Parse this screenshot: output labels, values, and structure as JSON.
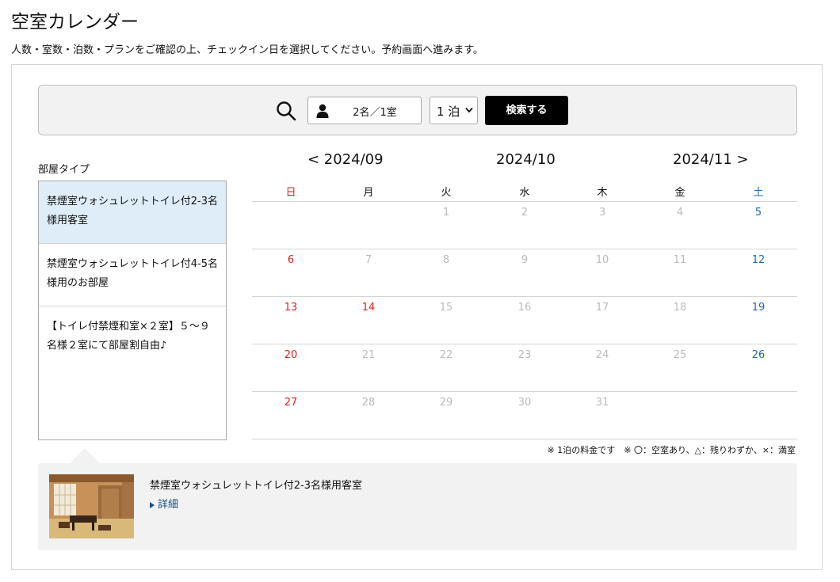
{
  "page": {
    "title": "空室カレンダー",
    "description": "人数・室数・泊数・プランをご確認の上、チェックイン日を選択してください。予約画面へ進みます。"
  },
  "search": {
    "guests_rooms": "2名／1室",
    "nights": "1 泊",
    "button_label": "検索する"
  },
  "rooms": {
    "label": "部屋タイプ",
    "items": [
      {
        "name": "禁煙室ウォシュレットトイレ付2-3名様用客室",
        "selected": true
      },
      {
        "name": "禁煙室ウォシュレットトイレ付4-5名様用のお部屋",
        "selected": false
      },
      {
        "name": "【トイレ付禁煙和室×２室】５〜９名様２室にて部屋割自由♪",
        "selected": false
      }
    ]
  },
  "calendar": {
    "prev_month": "< 2024/09",
    "current_month": "2024/10",
    "next_month": "2024/11 >",
    "weekdays": [
      "日",
      "月",
      "火",
      "水",
      "木",
      "金",
      "土"
    ],
    "weeks": [
      [
        "",
        "",
        "1",
        "2",
        "3",
        "4",
        "5"
      ],
      [
        "6",
        "7",
        "8",
        "9",
        "10",
        "11",
        "12"
      ],
      [
        "13",
        "14",
        "15",
        "16",
        "17",
        "18",
        "19"
      ],
      [
        "20",
        "21",
        "22",
        "23",
        "24",
        "25",
        "26"
      ],
      [
        "27",
        "28",
        "29",
        "30",
        "31",
        "",
        ""
      ]
    ],
    "holidays": [
      "14"
    ],
    "legend": "※ 1泊の料金です　※ 〇：空室あり、△：残りわずか、×：満室"
  },
  "detail": {
    "title": "禁煙室ウォシュレットトイレ付2-3名様用客室",
    "link_label": "詳細"
  },
  "colors": {
    "sunday": "#dd2222",
    "saturday": "#2068b8",
    "selected_room_bg": "#deedf7",
    "button_bg": "#000000"
  }
}
